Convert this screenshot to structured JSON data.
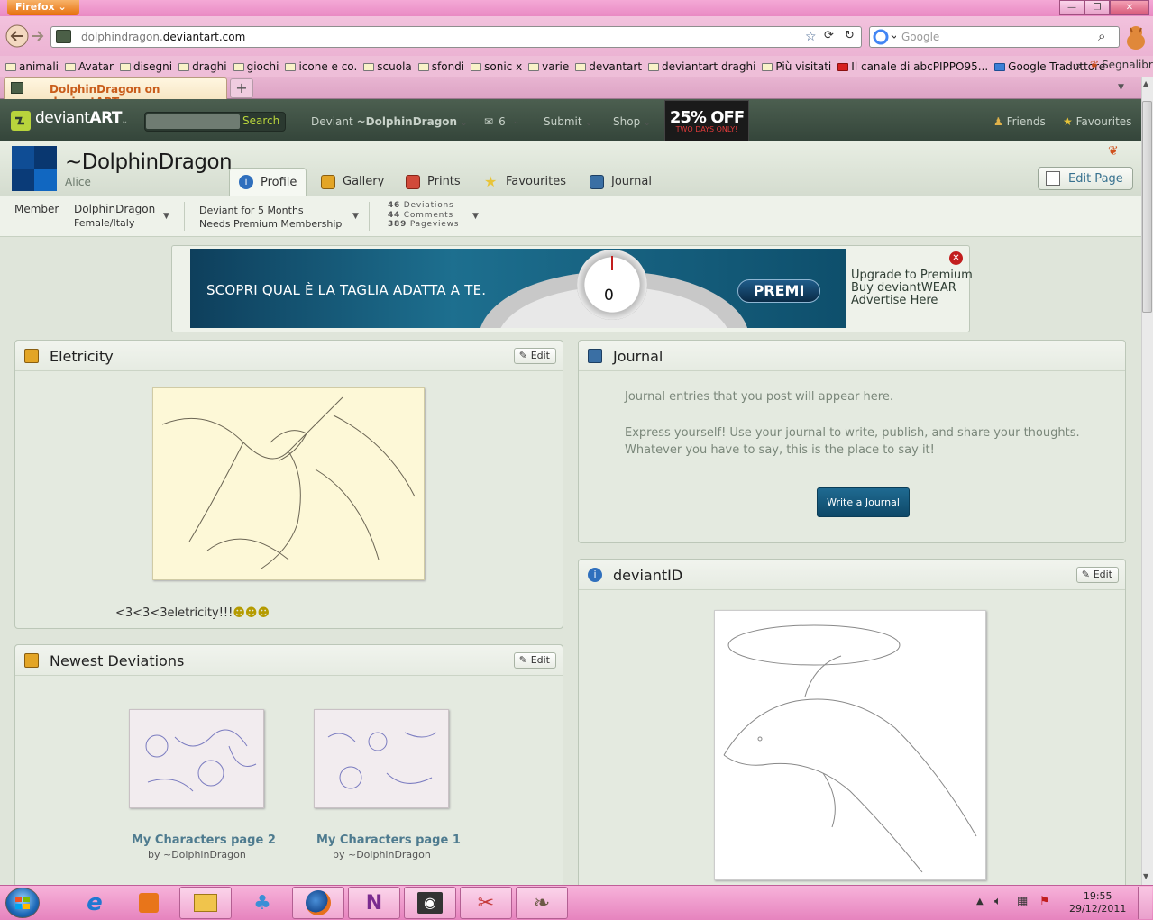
{
  "browser": {
    "app_button": "Firefox",
    "url_host_prefix": "dolphindragon.",
    "url_host_domain": "deviantart.com",
    "search_placeholder": "Google",
    "bookmarks": [
      "animali",
      "Avatar",
      "disegni",
      "draghi",
      "giochi",
      "icone e co.",
      "scuola",
      "sfondi",
      "sonic x",
      "varie",
      "devantart",
      "deviantart draghi",
      "Più visitati",
      "Il canale di abcPIPPO95...",
      "Google Traduttore"
    ],
    "bookmarks_more": "»",
    "bookmarks_menu": "Segnalibri",
    "tab_title": "DolphinDragon on deviantART",
    "new_tab": "+"
  },
  "da_header": {
    "logo_pre": "deviant",
    "logo_bold": "ART",
    "search_button": "Search",
    "user_menu_prefix": "Deviant",
    "user_menu_name": "~DolphinDragon",
    "messages_count": "6",
    "submit": "Submit",
    "shop": "Shop",
    "promo_big": "25% OFF",
    "promo_small": "TWO DAYS ONLY!",
    "friends": "Friends",
    "favourites": "Favourites"
  },
  "profile": {
    "username": "~DolphinDragon",
    "realname": "Alice",
    "tabs": [
      "Profile",
      "Gallery",
      "Prints",
      "Favourites",
      "Journal"
    ],
    "edit_page": "Edit Page",
    "stats": {
      "member": "Member",
      "name": "DolphinDragon",
      "location": "Female/Italy",
      "deviant_for": "Deviant for 5 Months",
      "membership": "Needs Premium Membership",
      "deviations_num": "46",
      "deviations_label": "Deviations",
      "comments_num": "44",
      "comments_label": "Comments",
      "pageviews_num": "389",
      "pageviews_label": "Pageviews"
    }
  },
  "ad": {
    "banner_text": "SCOPRI QUAL È LA TAGLIA ADATTA A TE.",
    "button": "PREMI",
    "gauge_value": "0",
    "links": [
      "Upgrade to Premium",
      "Buy deviantWEAR",
      "Advertise Here"
    ]
  },
  "widgets": {
    "eletricity": {
      "title": "Eletricity",
      "edit": "Edit",
      "caption": "<3<3<3eletricity!!!"
    },
    "newest": {
      "title": "Newest Deviations",
      "edit": "Edit",
      "items": [
        {
          "title": "My Characters page 2",
          "by": "by ~DolphinDragon"
        },
        {
          "title": "My Characters page 1",
          "by": "by ~DolphinDragon"
        }
      ]
    },
    "journal": {
      "title": "Journal",
      "line1": "Journal entries that you post will appear here.",
      "line2": "Express yourself! Use your journal to write, publish, and share your thoughts. Whatever you have to say, this is the place to say it!",
      "button": "Write a Journal"
    },
    "deviantid": {
      "title": "deviantID",
      "edit": "Edit"
    }
  },
  "taskbar": {
    "time": "19:55",
    "date": "29/12/2011"
  },
  "colors": {
    "accent_green": "#b8d43c",
    "link_blue": "#37718f",
    "ad_blue": "#1d6f8f",
    "taskbar_pink": "#e683be"
  }
}
